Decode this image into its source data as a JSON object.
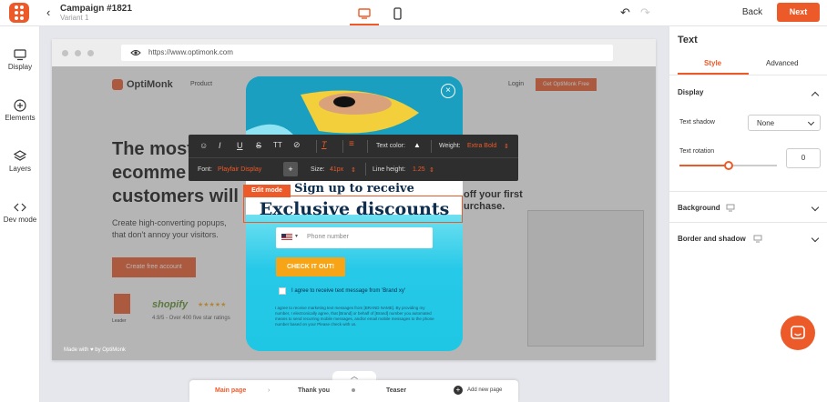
{
  "topbar": {
    "campaign_title": "Campaign #1821",
    "variant": "Variant 1",
    "back_label": "Back",
    "next_label": "Next"
  },
  "sidebar": {
    "items": [
      {
        "label": "Display",
        "icon": "monitor-icon"
      },
      {
        "label": "Elements",
        "icon": "plus-circle-icon"
      },
      {
        "label": "Layers",
        "icon": "layers-icon"
      },
      {
        "label": "Dev mode",
        "icon": "code-icon"
      }
    ]
  },
  "browser": {
    "url": "https://www.optimonk.com"
  },
  "website": {
    "brand": "OptiMonk",
    "nav_product": "Product",
    "nav_login": "Login",
    "cta_top": "Get OptiMonk Free",
    "headline_1": "The most",
    "headline_2": "ecomme",
    "headline_3": "customers will",
    "subtext_1": "Create high-converting popups,",
    "subtext_2": "that don't annoy your visitors.",
    "cta_main": "Create free account",
    "right_head_1": "off your first",
    "right_head_2": "urchase.",
    "leader_badge": "Leader",
    "shopify": "shopify",
    "stars": "★★★★★",
    "rating": "4.9/5 - Over 400 five star ratings",
    "made_with": "Made with ♥ by OptiMonk"
  },
  "toolbar": {
    "text_color_label": "Text color:",
    "weight_label": "Weight:",
    "weight_value": "Extra Bold",
    "font_label": "Font:",
    "font_value": "Playfair Display",
    "size_label": "Size:",
    "size_value": "41px",
    "line_height_label": "Line height:",
    "line_height_value": "1.25"
  },
  "popup": {
    "edit_mode": "Edit mode",
    "heading_1": "Sign up to receive",
    "heading_2": "Exclusive discounts",
    "phone_placeholder": "Phone number",
    "cta": "CHECK IT OUT!",
    "consent": "I agree to receive text message from 'Brand xy'",
    "legal": "I agree to receive marketing text messages from [BRAND NAME]. By providing my number, I electronically agree, that [Brand] or behalf of [Brand] number you automated means to send recurring mobile messages, and/or email mobile messages to the phone number based on your Please check with us."
  },
  "right_panel": {
    "title": "Text",
    "tab_style": "Style",
    "tab_advanced": "Advanced",
    "display_section": "Display",
    "text_shadow_label": "Text shadow",
    "text_shadow_value": "None",
    "text_rotation_label": "Text rotation",
    "text_rotation_value": "0",
    "rotation_slider_fraction": 0.5,
    "background_section": "Background",
    "border_section": "Border and shadow"
  },
  "page_tabs": {
    "main": "Main page",
    "thank_you": "Thank you",
    "teaser": "Teaser",
    "add_new": "Add new page"
  },
  "colors": {
    "accent": "#ed5a29",
    "popup_bg": "#22c6e6",
    "heading_dark": "#0d2d4d"
  }
}
